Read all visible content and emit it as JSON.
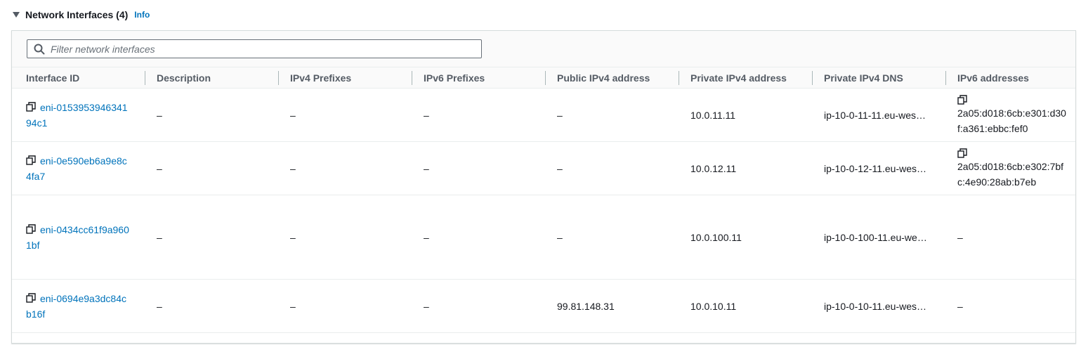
{
  "section": {
    "title": "Network Interfaces (4)",
    "info_label": "Info"
  },
  "filter": {
    "placeholder": "Filter network interfaces"
  },
  "table": {
    "columns": [
      "Interface ID",
      "Description",
      "IPv4 Prefixes",
      "IPv6 Prefixes",
      "Public IPv4 address",
      "Private IPv4 address",
      "Private IPv4 DNS",
      "IPv6 addresses"
    ],
    "rows": [
      {
        "interface_id": "eni-015395394634194c1",
        "description": "–",
        "ipv4_prefixes": "–",
        "ipv6_prefixes": "–",
        "public_ipv4": "–",
        "private_ipv4": "10.0.11.11",
        "private_dns": "ip-10-0-11-11.eu-wes…",
        "ipv6_address": "2a05:d018:6cb:e301:d30f:a361:ebbc:fef0"
      },
      {
        "interface_id": "eni-0e590eb6a9e8c4fa7",
        "description": "–",
        "ipv4_prefixes": "–",
        "ipv6_prefixes": "–",
        "public_ipv4": "–",
        "private_ipv4": "10.0.12.11",
        "private_dns": "ip-10-0-12-11.eu-wes…",
        "ipv6_address": "2a05:d018:6cb:e302:7bfc:4e90:28ab:b7eb"
      },
      {
        "interface_id": "eni-0434cc61f9a9601bf",
        "description": "–",
        "ipv4_prefixes": "–",
        "ipv6_prefixes": "–",
        "public_ipv4": "–",
        "private_ipv4": "10.0.100.11",
        "private_dns": "ip-10-0-100-11.eu-we…",
        "ipv6_address": "–"
      },
      {
        "interface_id": "eni-0694e9a3dc84cb16f",
        "description": "–",
        "ipv4_prefixes": "–",
        "ipv6_prefixes": "–",
        "public_ipv4": "99.81.148.31",
        "private_ipv4": "10.0.10.11",
        "private_dns": "ip-10-0-10-11.eu-wes…",
        "ipv6_address": "–"
      }
    ]
  },
  "icons": {
    "caret": "caret-down-icon",
    "search": "search-icon",
    "copy": "copy-icon"
  },
  "colors": {
    "link": "#0073bb",
    "header_text": "#545b64",
    "border": "#d5dbdb"
  }
}
